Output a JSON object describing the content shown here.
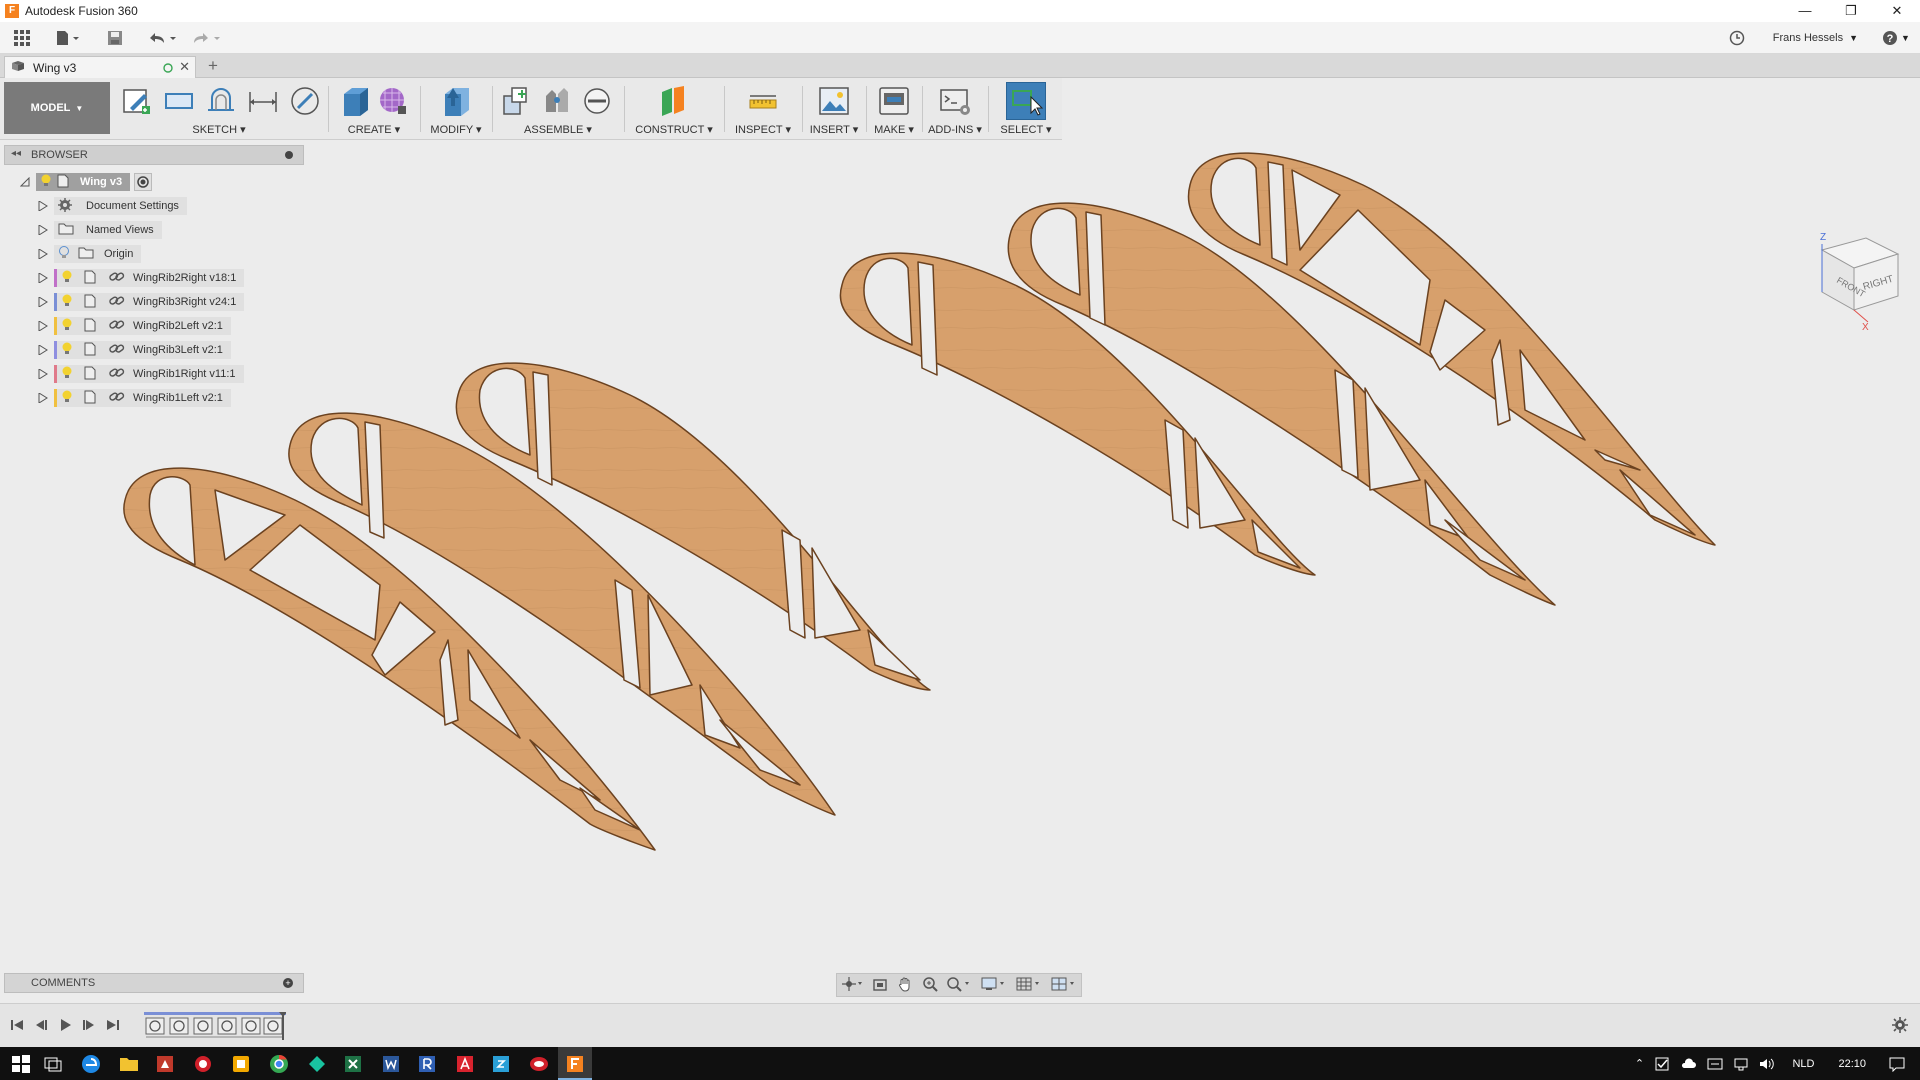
{
  "app": {
    "title": "Autodesk Fusion 360",
    "logo_letter": "F"
  },
  "window_controls": {
    "minimize": "—",
    "restore": "❐",
    "close": "✕"
  },
  "user": {
    "name": "Frans Hessels"
  },
  "document": {
    "tab_title": "Wing v3"
  },
  "toolbar": {
    "workspace": "MODEL",
    "groups": [
      "SKETCH",
      "CREATE",
      "MODIFY",
      "ASSEMBLE",
      "CONSTRUCT",
      "INSPECT",
      "INSERT",
      "MAKE",
      "ADD-INS",
      "SELECT"
    ]
  },
  "browser": {
    "title": "BROWSER",
    "root": "Wing v3",
    "items": [
      {
        "label": "Document Settings",
        "icon": "gear-icon"
      },
      {
        "label": "Named Views",
        "icon": "folder-icon"
      },
      {
        "label": "Origin",
        "icon": "folder-icon"
      },
      {
        "label": "WingRib2Right v18:1",
        "color": "#c070c8"
      },
      {
        "label": "WingRib3Right v24:1",
        "color": "#7a8fd6"
      },
      {
        "label": "WingRib2Left v2:1",
        "color": "#f0c040"
      },
      {
        "label": "WingRib3Left v2:1",
        "color": "#8f8fe0"
      },
      {
        "label": "WingRib1Right v11:1",
        "color": "#e07a8a"
      },
      {
        "label": "WingRib1Left v2:1",
        "color": "#f0c040"
      }
    ]
  },
  "comments": {
    "title": "COMMENTS"
  },
  "viewcube": {
    "front": "FRONT",
    "right": "RIGHT",
    "axis_z": "Z",
    "axis_x": "X"
  },
  "taskbar": {
    "language": "NLD",
    "time": "22:10"
  },
  "colors": {
    "wood": "#d7a06c",
    "wood_edge": "#8a5a2c",
    "select_active": "#3d7fb8"
  }
}
